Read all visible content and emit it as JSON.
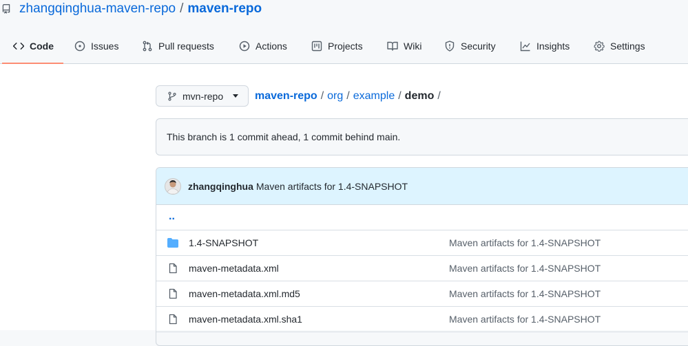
{
  "repo": {
    "owner": "zhangqinghua-maven-repo",
    "separator": "/",
    "name": "maven-repo"
  },
  "tabs": [
    {
      "label": "Code",
      "icon": "code-icon",
      "active": true
    },
    {
      "label": "Issues",
      "icon": "issue-icon"
    },
    {
      "label": "Pull requests",
      "icon": "pull-request-icon"
    },
    {
      "label": "Actions",
      "icon": "play-icon"
    },
    {
      "label": "Projects",
      "icon": "project-icon"
    },
    {
      "label": "Wiki",
      "icon": "book-icon"
    },
    {
      "label": "Security",
      "icon": "shield-icon"
    },
    {
      "label": "Insights",
      "icon": "graph-icon"
    },
    {
      "label": "Settings",
      "icon": "gear-icon"
    }
  ],
  "branch": {
    "name": "mvn-repo"
  },
  "path": {
    "root": "maven-repo",
    "segments": [
      "org",
      "example"
    ],
    "current": "demo",
    "separator": "/"
  },
  "flash": "This branch is 1 commit ahead, 1 commit behind main.",
  "latest_commit": {
    "author": "zhangqinghua",
    "message": "Maven artifacts for 1.4-SNAPSHOT"
  },
  "updir_label": "..",
  "files": [
    {
      "type": "folder",
      "name": "1.4-SNAPSHOT",
      "message": "Maven artifacts for 1.4-SNAPSHOT"
    },
    {
      "type": "file",
      "name": "maven-metadata.xml",
      "message": "Maven artifacts for 1.4-SNAPSHOT"
    },
    {
      "type": "file",
      "name": "maven-metadata.xml.md5",
      "message": "Maven artifacts for 1.4-SNAPSHOT"
    },
    {
      "type": "file",
      "name": "maven-metadata.xml.sha1",
      "message": "Maven artifacts for 1.4-SNAPSHOT"
    }
  ],
  "colors": {
    "link": "#0969da",
    "tab_underline": "#fd8c73",
    "commit_bar_bg": "#ddf4ff",
    "folder": "#54aeff"
  }
}
